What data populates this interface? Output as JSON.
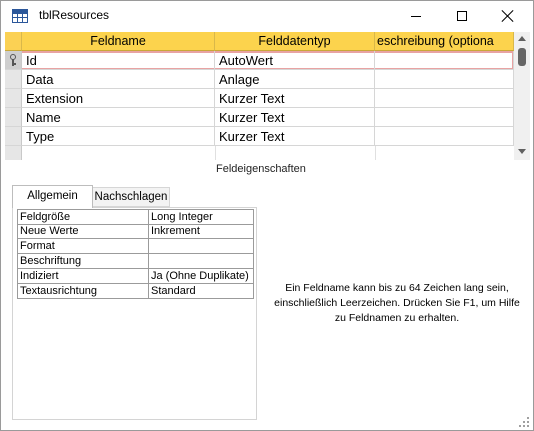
{
  "window": {
    "title": "tblResources"
  },
  "grid": {
    "columns": [
      "Feldname",
      "Felddatentyp",
      "eschreibung (optiona"
    ],
    "rows": [
      {
        "name": "Id",
        "type": "AutoWert",
        "description": "",
        "primary_key": true,
        "active": true
      },
      {
        "name": "Data",
        "type": "Anlage",
        "description": "",
        "primary_key": false,
        "active": false
      },
      {
        "name": "Extension",
        "type": "Kurzer Text",
        "description": "",
        "primary_key": false,
        "active": false
      },
      {
        "name": "Name",
        "type": "Kurzer Text",
        "description": "",
        "primary_key": false,
        "active": false
      },
      {
        "name": "Type",
        "type": "Kurzer Text",
        "description": "",
        "primary_key": false,
        "active": false
      }
    ]
  },
  "properties": {
    "section_label": "Feldeigenschaften",
    "tabs": [
      {
        "label": "Allgemein",
        "active": true
      },
      {
        "label": "Nachschlagen",
        "active": false
      }
    ],
    "rows": [
      {
        "label": "Feldgröße",
        "value": "Long Integer"
      },
      {
        "label": "Neue Werte",
        "value": "Inkrement"
      },
      {
        "label": "Format",
        "value": ""
      },
      {
        "label": "Beschriftung",
        "value": ""
      },
      {
        "label": "Indiziert",
        "value": "Ja (Ohne Duplikate)"
      },
      {
        "label": "Textausrichtung",
        "value": "Standard"
      }
    ],
    "help": "Ein Feldname kann bis zu 64 Zeichen lang sein, einschließlich Leerzeichen. Drücken Sie F1, um Hilfe zu Feldnamen zu erhalten."
  },
  "colors": {
    "header": "#fcd34d",
    "active_row_outline": "#e8a3a3",
    "icon_accent": "#2b579a"
  },
  "icons": {
    "app": "table-icon",
    "key": "primary-key-icon",
    "minimize": "minimize-icon",
    "maximize": "maximize-icon",
    "close": "close-icon"
  }
}
